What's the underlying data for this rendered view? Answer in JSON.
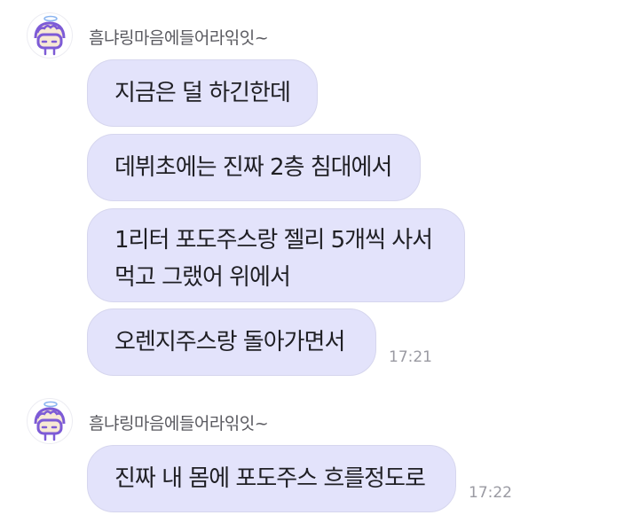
{
  "groups": [
    {
      "sender": "흠냐링마음에들어라읶잇~",
      "avatar_icon": "character-face-avatar-icon",
      "messages": [
        {
          "lines": [
            "지금은 덜 하긴한데"
          ]
        },
        {
          "lines": [
            "데뷔초에는 진짜 2층 침대에서"
          ]
        },
        {
          "lines": [
            "1리터 포도주스랑 젤리 5개씩 사서",
            "먹고 그랬어 위에서"
          ]
        },
        {
          "lines": [
            "오렌지주스랑 돌아가면서"
          ],
          "time": "17:21"
        }
      ]
    },
    {
      "sender": "흠냐링마음에들어라읶잇~",
      "avatar_icon": "character-face-avatar-icon",
      "messages": [
        {
          "lines": [
            "진짜 내 몸에 포도주스 흐를정도로"
          ],
          "time": "17:22"
        }
      ]
    }
  ],
  "colors": {
    "bubble": "#e3e3fb",
    "bubble_border": "#d6d6ee",
    "avatar_accent": "#7d5bd6",
    "timestamp": "#9a9aa2"
  }
}
